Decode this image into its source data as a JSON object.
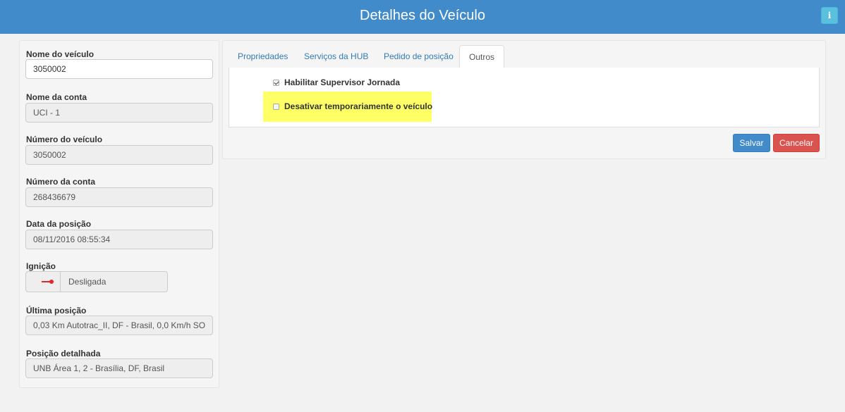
{
  "header": {
    "title": "Detalhes do Veículo",
    "info_icon_glyph": "i",
    "info_icon": "info-icon",
    "accent": "#428bca"
  },
  "fields": {
    "vehicle_name": {
      "label": "Nome do veículo",
      "value": "3050002"
    },
    "account_name": {
      "label": "Nome da conta",
      "value": "UCI - 1"
    },
    "vehicle_number": {
      "label": "Número do veículo",
      "value": "3050002"
    },
    "account_number": {
      "label": "Número da conta",
      "value": "268436679"
    },
    "position_date": {
      "label": "Data da posição",
      "value": "08/11/2016 08:55:34"
    },
    "ignition": {
      "label": "Ignição",
      "value": "Desligada",
      "icon": "key-icon",
      "icon_color": "#e32626"
    },
    "last_position": {
      "label": "Última posição",
      "value": "0,03 Km Autotrac_II, DF - Brasil, 0,0 Km/h SO"
    },
    "detailed_position": {
      "label": "Posição detalhada",
      "value": "UNB Área 1, 2 - Brasília, DF, Brasil"
    }
  },
  "tabs": [
    {
      "label": "Propriedades",
      "active": false
    },
    {
      "label": "Serviços da HUB",
      "active": false
    },
    {
      "label": "Pedido de posição",
      "active": false
    },
    {
      "label": "Outros",
      "active": true
    }
  ],
  "options": {
    "journey_supervisor": {
      "label": "Habilitar Supervisor Jornada",
      "checked": true
    },
    "disable_vehicle": {
      "label": "Desativar temporariamente o veículo",
      "checked": false,
      "highlight_color": "#ffff66"
    }
  },
  "actions": {
    "save_label": "Salvar",
    "cancel_label": "Cancelar",
    "save_color": "#428bca",
    "cancel_color": "#d9534f"
  }
}
